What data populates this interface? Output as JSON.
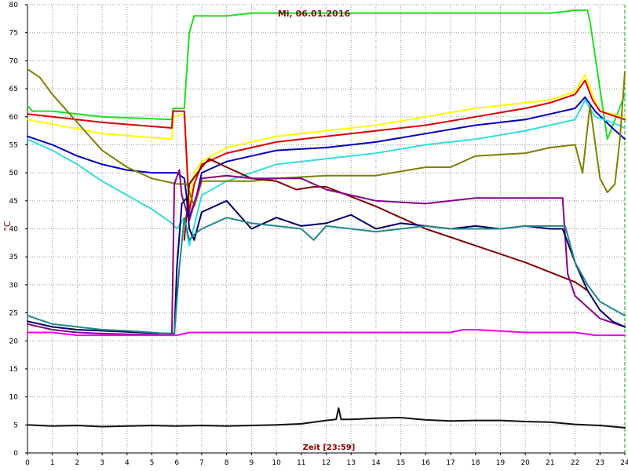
{
  "chart_data": {
    "type": "line",
    "title": "Mi, 06.01.2016",
    "xlabel": "Zeit [23:59]",
    "ylabel": "°C",
    "xlim": [
      0,
      24
    ],
    "ylim": [
      0,
      80
    ],
    "x_ticks": [
      "0",
      "1",
      "2",
      "3",
      "4",
      "5",
      "6",
      "7",
      "8",
      "9",
      "10",
      "11",
      "12",
      "13",
      "14",
      "15",
      "16",
      "17",
      "18",
      "19",
      "20",
      "21",
      "22",
      "23",
      "24"
    ],
    "y_ticks": [
      "0",
      "5",
      "10",
      "15",
      "20",
      "25",
      "30",
      "35",
      "40",
      "45",
      "50",
      "55",
      "60",
      "65",
      "70",
      "75",
      "80"
    ],
    "grid": true,
    "colors": {
      "grid": "#9a9a9a",
      "end_marker": "#00aa00"
    },
    "series": [
      {
        "color": "#22dd22",
        "x": [
          0,
          0.2,
          0.3,
          1,
          3,
          5.8,
          5.85,
          6.3,
          6.5,
          6.7,
          7,
          8,
          9,
          12,
          15,
          18,
          20,
          21,
          22,
          22.5,
          22.6,
          23,
          23.3,
          24
        ],
        "y": [
          62,
          61,
          61,
          61,
          60,
          59.5,
          61.5,
          61.5,
          75,
          78,
          78,
          78,
          78.5,
          78.5,
          78.5,
          78.5,
          78.5,
          78.5,
          79,
          79,
          77,
          65,
          56,
          64
        ]
      },
      {
        "color": "#ffff00",
        "x": [
          0,
          3,
          5.8,
          5.85,
          6.3,
          6.5,
          6.7,
          7,
          8,
          9,
          10,
          12,
          14,
          16,
          18,
          20,
          21,
          22,
          22.4,
          22.7,
          23,
          24
        ],
        "y": [
          59.5,
          57,
          56,
          60,
          60.5,
          45,
          50,
          52,
          54.5,
          55.5,
          56.5,
          57.5,
          58.5,
          60,
          61.5,
          62.5,
          63,
          64.5,
          67.5,
          64,
          61,
          60
        ]
      },
      {
        "color": "#dd0000",
        "x": [
          0,
          1,
          3,
          5.8,
          5.85,
          6.3,
          6.5,
          6.7,
          7,
          8,
          9,
          10,
          12,
          14,
          16,
          18,
          20,
          21,
          22,
          22.4,
          22.7,
          23,
          24
        ],
        "y": [
          60.5,
          60,
          59,
          58,
          61,
          61,
          43,
          48,
          51.5,
          53.5,
          54.5,
          55.5,
          56.5,
          57.5,
          58.5,
          60,
          61.5,
          62.5,
          64,
          66.5,
          63,
          61,
          59.5
        ]
      },
      {
        "color": "#0000bb",
        "x": [
          0,
          1,
          2,
          3,
          4,
          5,
          5.5,
          6,
          6.3,
          6.5,
          6.8,
          7,
          8,
          9,
          10,
          12,
          14,
          16,
          18,
          20,
          21,
          22,
          22.4,
          22.8,
          23.5,
          24
        ],
        "y": [
          56.5,
          55,
          53,
          51.5,
          50.5,
          50,
          50,
          50,
          49,
          42,
          46,
          50,
          52,
          53,
          54,
          54.5,
          55.5,
          57,
          58.5,
          59.5,
          60.5,
          61.5,
          63.5,
          61,
          58,
          56
        ]
      },
      {
        "color": "#33dddd",
        "x": [
          0,
          1,
          2,
          3,
          4,
          5,
          5.8,
          6,
          6.3,
          6.5,
          7,
          8,
          9,
          10,
          12,
          14,
          16,
          18,
          20,
          21,
          22,
          22.4,
          22.8,
          23.5,
          24
        ],
        "y": [
          56,
          54,
          51.5,
          48.5,
          46,
          43.5,
          41,
          40,
          42,
          37,
          46,
          48.5,
          50,
          51.5,
          52.5,
          53.5,
          55,
          56,
          57.5,
          58.5,
          59.5,
          63,
          60,
          59,
          58
        ]
      },
      {
        "color": "#808000",
        "x": [
          0,
          0.5,
          1,
          2,
          3,
          4,
          5,
          6,
          6.4,
          6.7,
          7,
          8,
          9,
          10,
          12,
          14,
          16,
          17,
          18,
          20,
          21,
          22,
          22.3,
          22.5,
          22.6,
          23,
          23.3,
          23.6,
          23.8,
          24
        ],
        "y": [
          68.5,
          67,
          64,
          59,
          54,
          51,
          49,
          48,
          48,
          44,
          48.5,
          48.5,
          48.5,
          49,
          49.5,
          49.5,
          51,
          51,
          53,
          53.5,
          54.5,
          55,
          50,
          58,
          62,
          49,
          46.5,
          48,
          56,
          68
        ]
      },
      {
        "color": "#800000",
        "x": [
          6.3,
          6.5,
          7,
          7.3,
          8,
          9,
          10,
          10.8,
          11.5,
          12,
          14,
          16,
          18,
          20,
          22,
          22.5
        ],
        "y": [
          38,
          48,
          51,
          52.5,
          51,
          49,
          48.5,
          47,
          47.5,
          47.5,
          44,
          40,
          37,
          34,
          30.5,
          29
        ]
      },
      {
        "color": "#880088",
        "x": [
          0,
          1,
          2,
          3,
          4,
          5,
          5.8,
          5.9,
          6.1,
          6.2,
          6.5,
          6.8,
          7,
          8,
          9,
          10,
          11,
          12,
          14,
          16,
          18,
          20,
          21.5,
          21.7,
          22,
          23,
          24
        ],
        "y": [
          23,
          22,
          21.5,
          21.3,
          21.2,
          21.1,
          21,
          48,
          50.5,
          46,
          41.5,
          46,
          49,
          49.5,
          49,
          49,
          49,
          47,
          45,
          44.5,
          45.5,
          45.5,
          45.5,
          32,
          28,
          24,
          22.5
        ]
      },
      {
        "color": "#000066",
        "x": [
          0,
          1,
          2,
          3,
          4,
          5,
          5.9,
          6,
          6.2,
          6.4,
          6.5,
          6.7,
          7,
          8,
          9,
          10,
          11,
          12,
          13,
          14,
          15,
          16,
          17,
          18,
          19,
          20,
          21,
          21.5,
          22,
          22.5,
          23,
          23.5,
          24
        ],
        "y": [
          23.5,
          22.5,
          22,
          21.8,
          21.6,
          21.4,
          21.3,
          33,
          44.5,
          45.5,
          40,
          38,
          43,
          45,
          40,
          42,
          40.5,
          41,
          42.5,
          40,
          41,
          40.5,
          40,
          40.5,
          40,
          40.5,
          40,
          40,
          34,
          29,
          25.5,
          23.5,
          22.5
        ]
      },
      {
        "color": "#228888",
        "x": [
          0,
          1,
          2,
          3,
          4,
          5,
          5.9,
          6.1,
          6.3,
          6.5,
          6.7,
          7,
          8,
          9,
          10,
          11,
          11.5,
          12,
          13,
          14,
          15,
          16,
          17,
          18,
          19,
          20,
          21,
          21.6,
          22,
          22.5,
          23,
          24
        ],
        "y": [
          24.5,
          23,
          22.5,
          22,
          21.8,
          21.5,
          21.2,
          33,
          42,
          38,
          39,
          40,
          42,
          41,
          40.5,
          40,
          38,
          40.5,
          40,
          39.5,
          40,
          40.5,
          40,
          40,
          40,
          40.5,
          40.5,
          40.5,
          34,
          30,
          27,
          24.5
        ]
      },
      {
        "color": "#ee00ee",
        "x": [
          0,
          1,
          2,
          3,
          4,
          5,
          5.8,
          6,
          6.5,
          8,
          9,
          10,
          12,
          14,
          16,
          17,
          17.5,
          18,
          20,
          22,
          22.8,
          24
        ],
        "y": [
          21.5,
          21.5,
          21,
          21,
          21,
          21,
          21,
          21,
          21.5,
          21.5,
          21.5,
          21.5,
          21.5,
          21.5,
          21.5,
          21.5,
          22,
          22,
          21.5,
          21.5,
          21,
          21
        ]
      },
      {
        "color": "#111111",
        "x": [
          0,
          1,
          2,
          3,
          4,
          5,
          6,
          7,
          8,
          9,
          10,
          11,
          11.5,
          12,
          12.4,
          12.5,
          12.6,
          13,
          14,
          15,
          16,
          17,
          18,
          19,
          20,
          21,
          22,
          23,
          24
        ],
        "y": [
          5,
          4.8,
          4.9,
          4.7,
          4.8,
          4.9,
          4.8,
          4.9,
          4.8,
          4.9,
          5,
          5.2,
          5.5,
          5.8,
          6,
          8,
          6,
          6,
          6.2,
          6.3,
          5.9,
          5.7,
          5.8,
          5.8,
          5.6,
          5.5,
          5.1,
          4.9,
          4.5
        ]
      }
    ]
  }
}
